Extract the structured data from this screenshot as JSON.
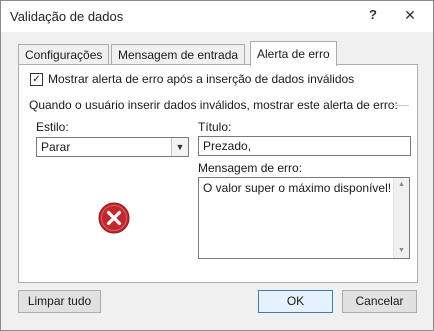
{
  "window": {
    "title": "Validação de dados",
    "help_label": "?",
    "close_label": "✕"
  },
  "tabs": [
    {
      "label": "Configurações"
    },
    {
      "label": "Mensagem de entrada"
    },
    {
      "label": "Alerta de erro",
      "active": true
    }
  ],
  "error_alert": {
    "checkbox_label": "Mostrar alerta de erro após a inserção de dados inválidos",
    "checkbox_checked": true,
    "section_text": "Quando o usuário inserir dados inválidos, mostrar este alerta de erro:",
    "style_label": "Estilo:",
    "style_value": "Parar",
    "title_label": "Título:",
    "title_value": "Prezado,",
    "message_label": "Mensagem de erro:",
    "message_value": "O valor super o máximo disponível!",
    "icon": "error-stop-icon"
  },
  "buttons": {
    "clear_all": "Limpar tudo",
    "ok": "OK",
    "cancel": "Cancelar"
  },
  "colors": {
    "error_icon": "#c1272d",
    "ok_border": "#3c7fb1"
  }
}
